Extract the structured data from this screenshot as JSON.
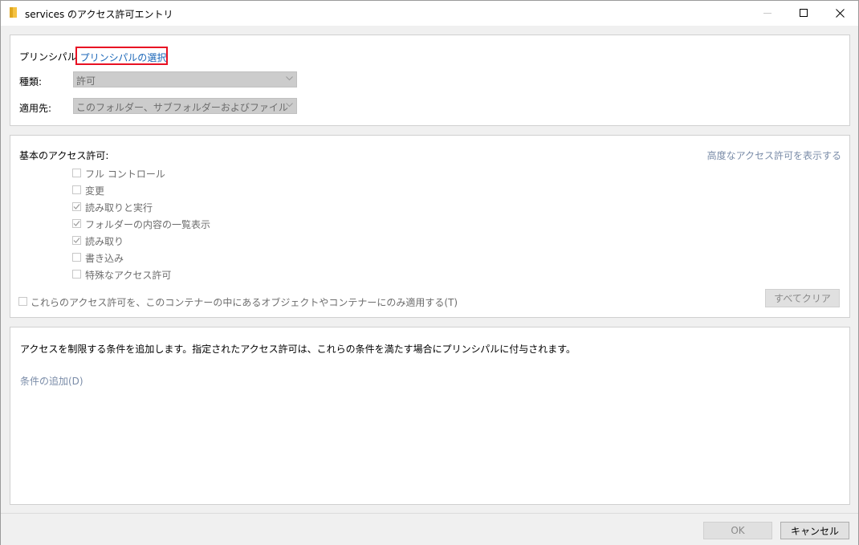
{
  "window": {
    "title": "services のアクセス許可エントリ",
    "minimize_icon": "minimize-icon",
    "maximize_icon": "maximize-icon",
    "close_icon": "close-icon"
  },
  "principal": {
    "label": "プリンシパル",
    "link": "プリンシパルの選択"
  },
  "type": {
    "label": "種類:",
    "value": "許可"
  },
  "applies_to": {
    "label": "適用先:",
    "value": "このフォルダー、サブフォルダーおよびファイル"
  },
  "permissions": {
    "heading": "基本のアクセス許可:",
    "advanced_link": "高度なアクセス許可を表示する",
    "items": [
      {
        "label": "フル コントロール",
        "checked": false
      },
      {
        "label": "変更",
        "checked": false
      },
      {
        "label": "読み取りと実行",
        "checked": true
      },
      {
        "label": "フォルダーの内容の一覧表示",
        "checked": true
      },
      {
        "label": "読み取り",
        "checked": true
      },
      {
        "label": "書き込み",
        "checked": false
      },
      {
        "label": "特殊なアクセス許可",
        "checked": false
      }
    ],
    "apply_only_label": "これらのアクセス許可を、このコンテナーの中にあるオブジェクトやコンテナーにのみ適用する(T)",
    "apply_only_checked": false,
    "clear_all": "すべてクリア"
  },
  "conditions": {
    "description": "アクセスを制限する条件を追加します。指定されたアクセス許可は、これらの条件を満たす場合にプリンシパルに付与されます。",
    "add_link": "条件の追加(D)"
  },
  "footer": {
    "ok": "OK",
    "cancel": "キャンセル"
  },
  "colors": {
    "highlight_border": "#e81123",
    "link": "#1a66b8",
    "disabled_text": "#6d6d6d"
  }
}
